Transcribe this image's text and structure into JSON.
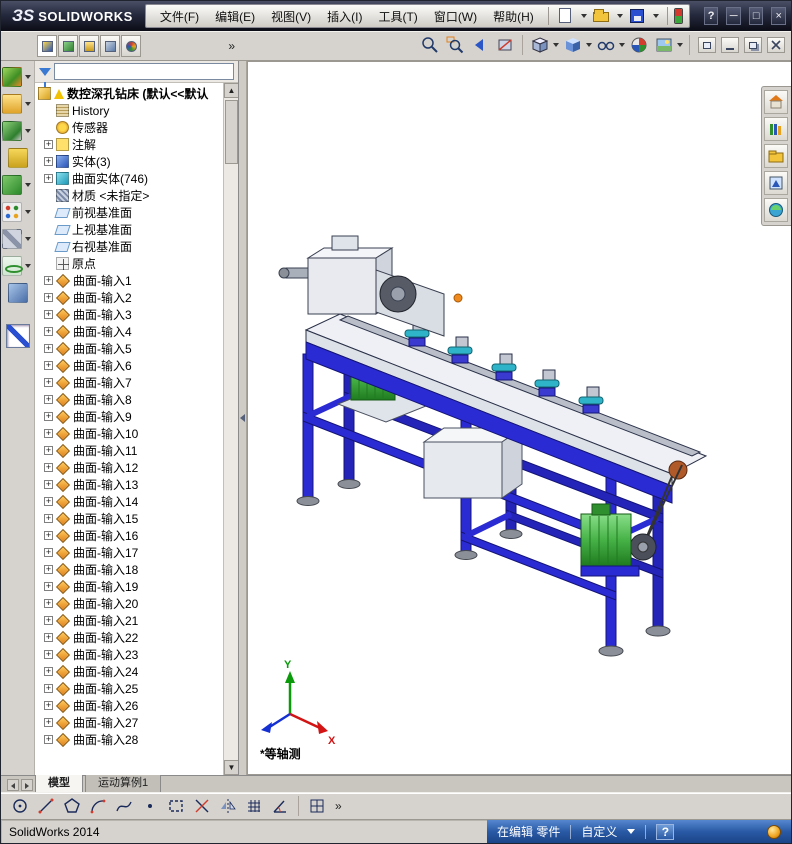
{
  "titlebar": {
    "logo_mark": "ЗS",
    "logo_text": "SOLIDWORKS",
    "menus": [
      "文件(F)",
      "编辑(E)",
      "视图(V)",
      "插入(I)",
      "工具(T)",
      "窗口(W)",
      "帮助(H)"
    ],
    "help": "?",
    "minimize": "─",
    "maximize": "□",
    "close": "×"
  },
  "glyphs": {
    "chevron": "»",
    "expand": "+",
    "up_arrow": "▲",
    "down_arrow": "▼"
  },
  "feature_panel": {
    "root_label": "数控深孔钻床 (默认<<默认",
    "items": [
      {
        "label": "History"
      },
      {
        "label": "传感器"
      },
      {
        "label": "注解"
      },
      {
        "label": "实体(3)"
      },
      {
        "label": "曲面实体(746)"
      },
      {
        "label": "材质 <未指定>"
      },
      {
        "label": "前视基准面"
      },
      {
        "label": "上视基准面"
      },
      {
        "label": "右视基准面"
      },
      {
        "label": "原点"
      }
    ],
    "surface_items": [
      "曲面-输入1",
      "曲面-输入2",
      "曲面-输入3",
      "曲面-输入4",
      "曲面-输入5",
      "曲面-输入6",
      "曲面-输入7",
      "曲面-输入8",
      "曲面-输入9",
      "曲面-输入10",
      "曲面-输入11",
      "曲面-输入12",
      "曲面-输入13",
      "曲面-输入14",
      "曲面-输入15",
      "曲面-输入16",
      "曲面-输入17",
      "曲面-输入18",
      "曲面-输入19",
      "曲面-输入20",
      "曲面-输入21",
      "曲面-输入22",
      "曲面-输入23",
      "曲面-输入24",
      "曲面-输入25",
      "曲面-输入26",
      "曲面-输入27",
      "曲面-输入28"
    ]
  },
  "viewport": {
    "view_label": "*等轴测",
    "axis_x": "X",
    "axis_y": "Y"
  },
  "doc_tabs": {
    "model": "模型",
    "motion": "运动算例1"
  },
  "statusbar": {
    "app_version": "SolidWorks 2014",
    "edit_status": "在编辑 零件",
    "units": "自定义",
    "help": "?"
  }
}
